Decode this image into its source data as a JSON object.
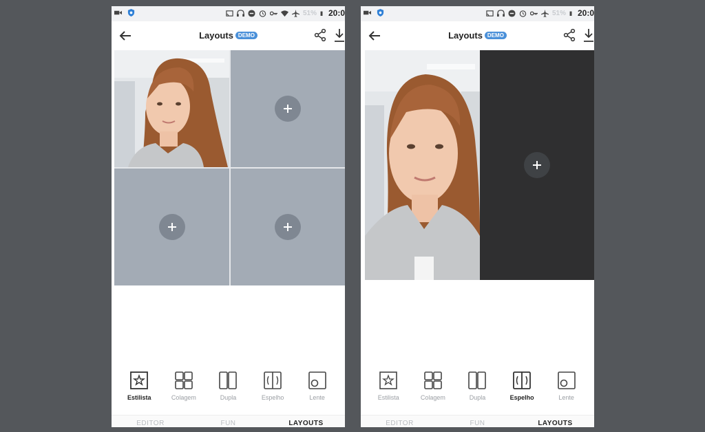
{
  "screens": [
    {
      "status": {
        "battery_pct": "51%",
        "time": "20:0"
      },
      "title": "Layouts",
      "badge": "DEMO",
      "tools": [
        {
          "label": "Estilista",
          "icon": "star-frame-icon",
          "active": true
        },
        {
          "label": "Colagem",
          "icon": "grid-icon",
          "active": false
        },
        {
          "label": "Dupla",
          "icon": "double-frame-icon",
          "active": false
        },
        {
          "label": "Espelho",
          "icon": "mirror-icon",
          "active": false
        },
        {
          "label": "Lente",
          "icon": "lens-icon",
          "active": false
        }
      ],
      "tabs": [
        {
          "label": "EDITOR",
          "active": false
        },
        {
          "label": "FUN",
          "active": false
        },
        {
          "label": "LAYOUTS",
          "active": true
        }
      ]
    },
    {
      "status": {
        "battery_pct": "51%",
        "time": "20:0"
      },
      "title": "Layouts",
      "badge": "DEMO",
      "tools": [
        {
          "label": "Estilista",
          "icon": "star-frame-icon",
          "active": false
        },
        {
          "label": "Colagem",
          "icon": "grid-icon",
          "active": false
        },
        {
          "label": "Dupla",
          "icon": "double-frame-icon",
          "active": false
        },
        {
          "label": "Espelho",
          "icon": "mirror-icon",
          "active": true
        },
        {
          "label": "Lente",
          "icon": "lens-icon",
          "active": false
        }
      ],
      "tabs": [
        {
          "label": "EDITOR",
          "active": false
        },
        {
          "label": "FUN",
          "active": false
        },
        {
          "label": "LAYOUTS",
          "active": true
        }
      ]
    }
  ],
  "colors": {
    "background": "#54575b",
    "empty_cell": "#a3abb5",
    "empty_cell_dark": "#2f2f30",
    "badge": "#4a90d9"
  }
}
